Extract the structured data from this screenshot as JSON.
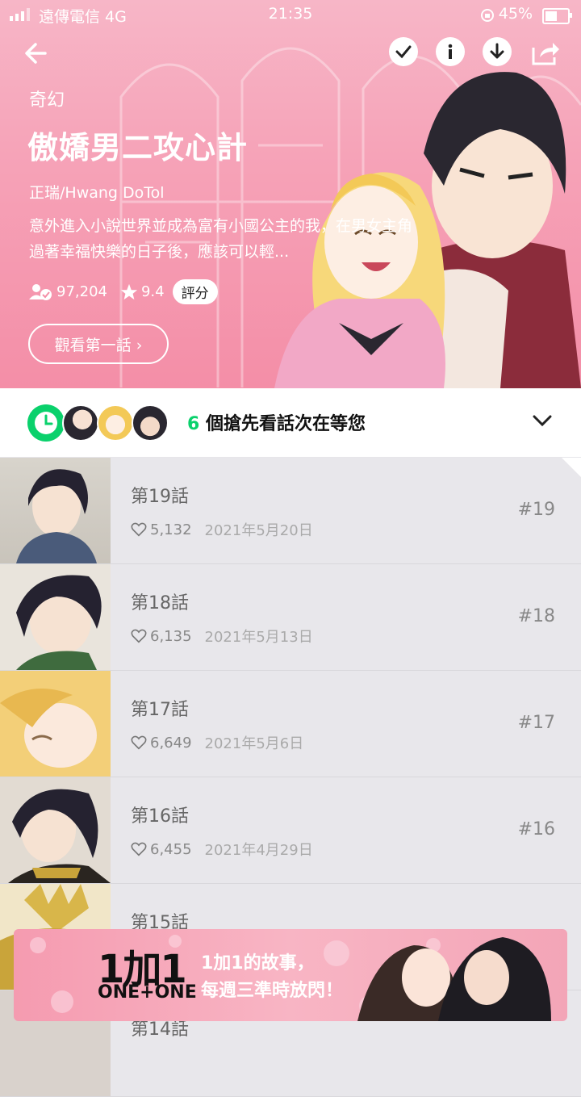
{
  "status_bar": {
    "carrier": "遠傳電信 4G",
    "time": "21:35",
    "battery": "45%"
  },
  "header": {
    "genre": "奇幻",
    "title": "傲嬌男二攻心計",
    "author": "正瑞/Hwang DoTol",
    "synopsis": "意外進入小說世界並成為富有小國公主的我，在男女主角過著幸福快樂的日子後，應該可以輕...",
    "subscribers": "97,204",
    "rating": "9.4",
    "rate_label": "評分",
    "read_first_label": "觀看第一話 ›"
  },
  "wait_bar": {
    "count": "6",
    "text": " 個搶先看話次在等您"
  },
  "episodes": [
    {
      "title": "第19話",
      "likes": "5,132",
      "date": "2021年5月20日",
      "num": "#19"
    },
    {
      "title": "第18話",
      "likes": "6,135",
      "date": "2021年5月13日",
      "num": "#18"
    },
    {
      "title": "第17話",
      "likes": "6,649",
      "date": "2021年5月6日",
      "num": "#17"
    },
    {
      "title": "第16話",
      "likes": "6,455",
      "date": "2021年4月29日",
      "num": "#16"
    },
    {
      "title": "第15話",
      "likes": "",
      "date": "",
      "num": ""
    },
    {
      "title": "第14話",
      "likes": "",
      "date": "",
      "num": ""
    }
  ],
  "banner": {
    "logo_main": "1加1",
    "logo_sub": "ONE+ONE",
    "line1": "1加1的故事，",
    "line2": "每週三準時放閃！"
  },
  "colors": {
    "accent_green": "#0ad16c",
    "hero_pink": "#f6a3b8"
  }
}
